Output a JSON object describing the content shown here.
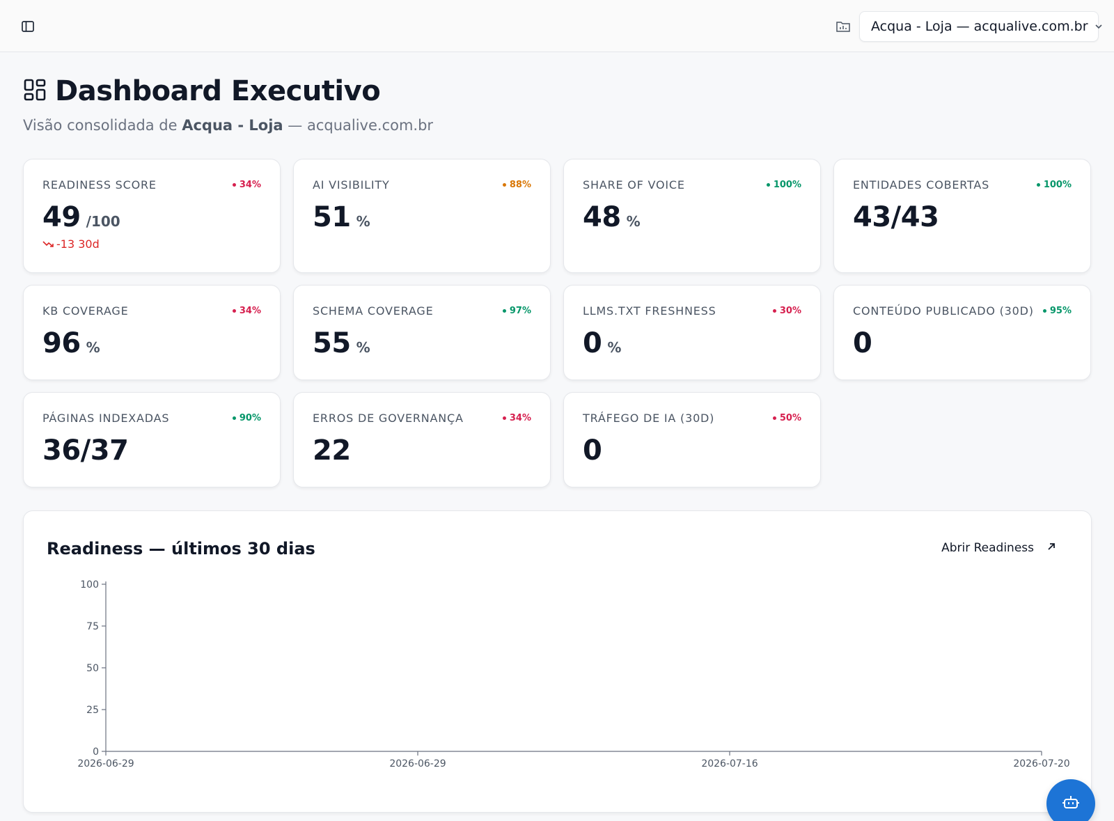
{
  "header": {
    "project_selector": "Acqua - Loja — acqualive.com.br"
  },
  "page": {
    "title": "Dashboard Executivo",
    "subtitle_prefix": "Visão consolidada de ",
    "subtitle_project": "Acqua - Loja",
    "subtitle_suffix": " — acqualive.com.br"
  },
  "colors": {
    "red": "#d6204f",
    "orange": "#d97706",
    "green": "#059669",
    "delta_red": "#dc2626"
  },
  "cards": [
    {
      "label": "READINESS SCORE",
      "badge": "34%",
      "badge_color": "red",
      "value": "49",
      "unit": "/100",
      "delta": "-13 30d"
    },
    {
      "label": "AI VISIBILITY",
      "badge": "88%",
      "badge_color": "orange",
      "value": "51",
      "unit": "%"
    },
    {
      "label": "SHARE OF VOICE",
      "badge": "100%",
      "badge_color": "green",
      "value": "48",
      "unit": "%"
    },
    {
      "label": "ENTIDADES COBERTAS",
      "badge": "100%",
      "badge_color": "green",
      "value": "43/43",
      "unit": ""
    },
    {
      "label": "KB COVERAGE",
      "badge": "34%",
      "badge_color": "red",
      "value": "96",
      "unit": "%"
    },
    {
      "label": "SCHEMA COVERAGE",
      "badge": "97%",
      "badge_color": "green",
      "value": "55",
      "unit": "%"
    },
    {
      "label": "LLMS.TXT FRESHNESS",
      "badge": "30%",
      "badge_color": "red",
      "value": "0",
      "unit": "%"
    },
    {
      "label": "CONTEÚDO PUBLICADO (30D)",
      "badge": "95%",
      "badge_color": "green",
      "value": "0",
      "unit": ""
    },
    {
      "label": "PÁGINAS INDEXADAS",
      "badge": "90%",
      "badge_color": "green",
      "value": "36/37",
      "unit": ""
    },
    {
      "label": "ERROS DE GOVERNANÇA",
      "badge": "34%",
      "badge_color": "red",
      "value": "22",
      "unit": ""
    },
    {
      "label": "TRÁFEGO DE IA (30D)",
      "badge": "50%",
      "badge_color": "red",
      "value": "0",
      "unit": ""
    }
  ],
  "chart_section": {
    "title": "Readiness — últimos 30 dias",
    "open_link": "Abrir Readiness"
  },
  "chart_data": {
    "type": "line",
    "title": "Readiness — últimos 30 dias",
    "xlabel": "",
    "ylabel": "",
    "ylim": [
      0,
      100
    ],
    "yticks": [
      0,
      25,
      50,
      75,
      100
    ],
    "xticks": [
      "2026-06-29",
      "2026-06-29",
      "2026-07-16",
      "2026-07-20"
    ],
    "grid": false,
    "series": []
  },
  "icons": {
    "sidebar_toggle": "sidebar-panel-icon",
    "project": "folder-chart-icon",
    "title": "layout-dashboard-icon",
    "trend": "trending-down-icon",
    "open_link": "arrow-up-right-icon",
    "fab": "bot-icon"
  }
}
